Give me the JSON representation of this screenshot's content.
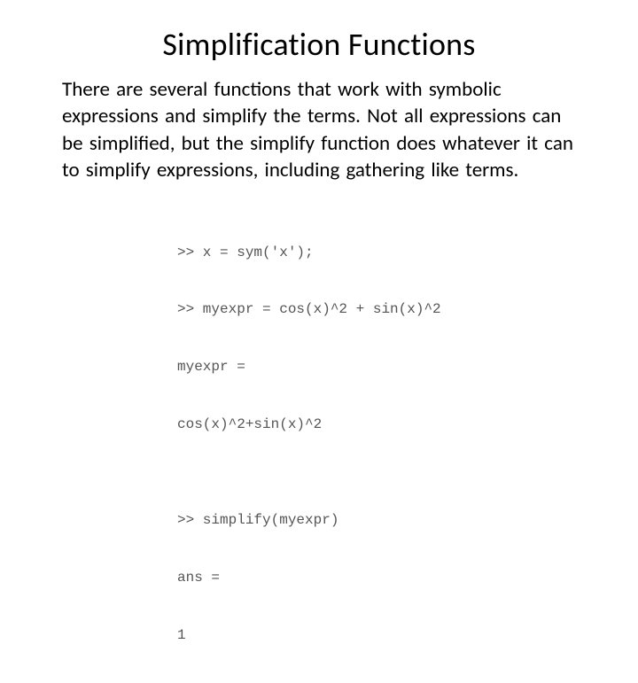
{
  "title": "Simplification Functions",
  "paragraph": "There are several functions that work with symbolic expressions and simplify the terms. Not all expressions can be simpliﬁed, but the simplify function does whatever it can to simplify expressions, including gathering like terms.",
  "code": {
    "l1": ">> x = sym('x');",
    "l2": ">> myexpr = cos(x)^2 + sin(x)^2",
    "l3": "myexpr =",
    "l4": "cos(x)^2+sin(x)^2",
    "l5": "",
    "l6": ">> simplify(myexpr)",
    "l7": "ans =",
    "l8": "1"
  }
}
